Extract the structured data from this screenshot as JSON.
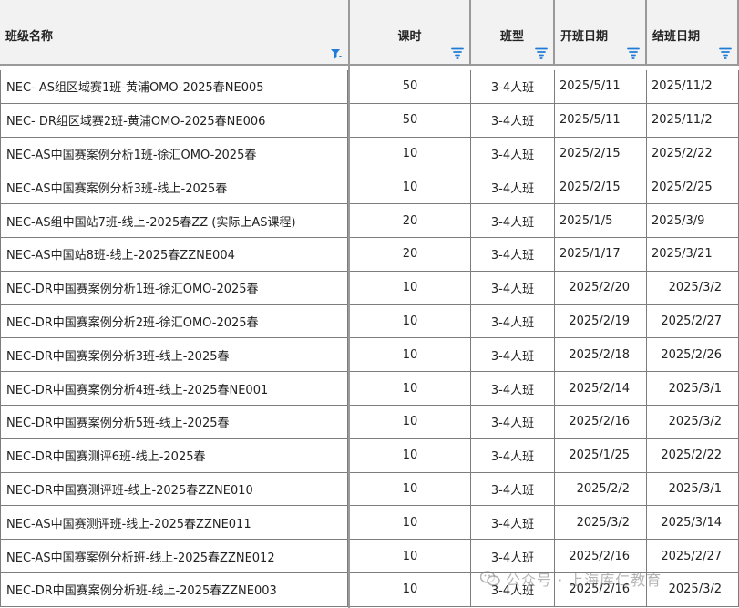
{
  "headers": {
    "name": "班级名称",
    "hours": "课时",
    "type": "班型",
    "start": "开班日期",
    "end": "结班日期"
  },
  "rows": [
    {
      "name": "NEC- AS组区域赛1班-黄浦OMO-2025春NE005",
      "hours": "50",
      "type": "3-4人班",
      "start": "2025/5/11",
      "end": "2025/11/2"
    },
    {
      "name": "NEC- DR组区域赛2班-黄浦OMO-2025春NE006",
      "hours": "50",
      "type": "3-4人班",
      "start": "2025/5/11",
      "end": "2025/11/2"
    },
    {
      "name": "NEC-AS中国赛案例分析1班-徐汇OMO-2025春",
      "hours": "10",
      "type": "3-4人班",
      "start": "2025/2/15",
      "end": "2025/2/22"
    },
    {
      "name": "NEC-AS中国赛案例分析3班-线上-2025春",
      "hours": "10",
      "type": "3-4人班",
      "start": "2025/2/15",
      "end": "2025/2/25"
    },
    {
      "name": "NEC-AS组中国站7班-线上-2025春ZZ (实际上AS课程)",
      "hours": "20",
      "type": "3-4人班",
      "start": "2025/1/5",
      "end": "2025/3/9"
    },
    {
      "name": "NEC-AS中国站8班-线上-2025春ZZNE004",
      "hours": "20",
      "type": "3-4人班",
      "start": "2025/1/17",
      "end": "2025/3/21"
    },
    {
      "name": "NEC-DR中国赛案例分析1班-徐汇OMO-2025春",
      "hours": "10",
      "type": "3-4人班",
      "start": "2025/2/20",
      "end": "2025/3/2"
    },
    {
      "name": "NEC-DR中国赛案例分析2班-徐汇OMO-2025春",
      "hours": "10",
      "type": "3-4人班",
      "start": "2025/2/19",
      "end": "2025/2/27"
    },
    {
      "name": "NEC-DR中国赛案例分析3班-线上-2025春",
      "hours": "10",
      "type": "3-4人班",
      "start": "2025/2/18",
      "end": "2025/2/26"
    },
    {
      "name": "NEC-DR中国赛案例分析4班-线上-2025春NE001",
      "hours": "10",
      "type": "3-4人班",
      "start": "2025/2/14",
      "end": "2025/3/1"
    },
    {
      "name": "NEC-DR中国赛案例分析5班-线上-2025春",
      "hours": "10",
      "type": "3-4人班",
      "start": "2025/2/16",
      "end": "2025/3/2"
    },
    {
      "name": "NEC-DR中国赛测评6班-线上-2025春",
      "hours": "10",
      "type": "3-4人班",
      "start": "2025/1/25",
      "end": "2025/2/22"
    },
    {
      "name": "NEC-DR中国赛测评班-线上-2025春ZZNE010",
      "hours": "10",
      "type": "3-4人班",
      "start": "2025/2/2",
      "end": "2025/3/1"
    },
    {
      "name": "NEC-AS中国赛测评班-线上-2025春ZZNE011",
      "hours": "10",
      "type": "3-4人班",
      "start": "2025/3/2",
      "end": "2025/3/14"
    },
    {
      "name": "NEC-AS中国赛案例分析班-线上-2025春ZZNE012",
      "hours": "10",
      "type": "3-4人班",
      "start": "2025/2/16",
      "end": "2025/2/27"
    },
    {
      "name": "NEC-DR中国赛案例分析班-线上-2025春ZZNE003",
      "hours": "10",
      "type": "3-4人班",
      "start": "2025/2/16",
      "end": "2025/3/2"
    }
  ],
  "watermark": "公众号 · 上海库仁教育",
  "colors": {
    "filter_icon": "#1e7bd8",
    "header_bg": "#f2f2f2",
    "grid": "#7d7d7d"
  }
}
